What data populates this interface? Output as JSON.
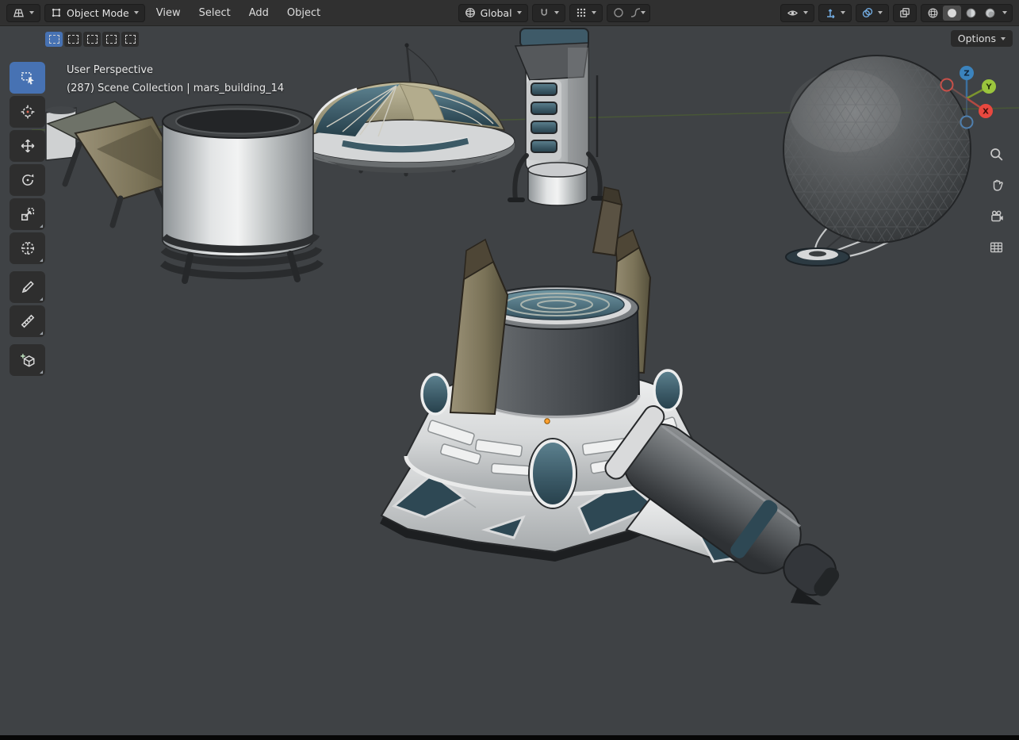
{
  "header": {
    "mode_label": "Object Mode",
    "menus": [
      "View",
      "Select",
      "Add",
      "Object"
    ],
    "orientation_label": "Global"
  },
  "tool_settings": {
    "options_label": "Options",
    "select_modes": [
      "set",
      "extend",
      "subtract",
      "invert",
      "intersect"
    ]
  },
  "viewport_overlay": {
    "perspective": "User Perspective",
    "scene_info": "(287) Scene Collection | mars_building_14"
  },
  "nav_gizmo": {
    "x": "X",
    "y": "Y",
    "z": "Z"
  },
  "toolbar_tools": [
    "select-box",
    "cursor",
    "move",
    "rotate",
    "scale",
    "transform",
    "annotate",
    "measure",
    "add-cube"
  ],
  "side_tools": [
    "zoom",
    "pan",
    "camera-view",
    "toggle-orthographic"
  ],
  "colors": {
    "accent_blue": "#4772b3",
    "axis_x": "#e8483f",
    "axis_y": "#9bc53d",
    "axis_z": "#3b83bd",
    "viewport_bg": "#3f4245",
    "teal_glass": "#3e5a68"
  }
}
